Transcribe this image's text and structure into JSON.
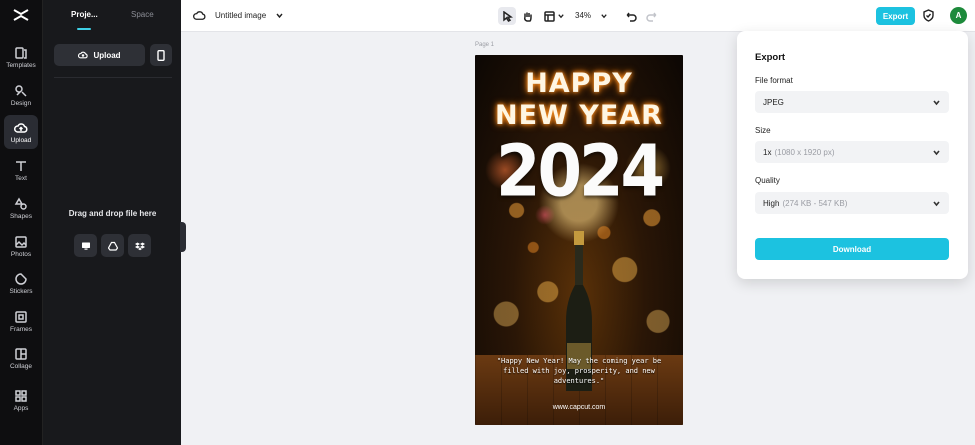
{
  "rail": {
    "items": [
      {
        "label": "Templates",
        "icon": "templates-icon"
      },
      {
        "label": "Design",
        "icon": "design-icon"
      },
      {
        "label": "Upload",
        "icon": "upload-cloud-icon",
        "active": true
      },
      {
        "label": "Text",
        "icon": "text-icon"
      },
      {
        "label": "Shapes",
        "icon": "shapes-icon"
      },
      {
        "label": "Photos",
        "icon": "photos-icon"
      },
      {
        "label": "Stickers",
        "icon": "stickers-icon"
      },
      {
        "label": "Frames",
        "icon": "frames-icon"
      },
      {
        "label": "Collage",
        "icon": "collage-icon"
      },
      {
        "label": "Apps",
        "icon": "apps-icon"
      }
    ]
  },
  "panel": {
    "tabs": [
      "Proje...",
      "Space"
    ],
    "upload_label": "Upload",
    "drop_text": "Drag and drop file here"
  },
  "topbar": {
    "doc_title": "Untitled image",
    "zoom": "34%",
    "export_label": "Export",
    "avatar_initial": "A"
  },
  "canvas": {
    "page_label": "Page 1",
    "poster": {
      "line1": "HAPPY",
      "line2": "NEW YEAR",
      "year": "2024",
      "quote": "\"Happy New Year! May the coming year be filled with joy, prosperity, and new adventures.\"",
      "site": "www.capcut.com"
    }
  },
  "export_panel": {
    "title": "Export",
    "file_format_label": "File format",
    "file_format_value": "JPEG",
    "size_label": "Size",
    "size_value": "1x",
    "size_hint": "(1080 x 1920 px)",
    "quality_label": "Quality",
    "quality_value": "High",
    "quality_hint": "(274 KB - 547 KB)",
    "download_label": "Download"
  },
  "colors": {
    "accent": "#1cc2e0",
    "rail_bg": "#0e0e10",
    "panel_bg": "#18191c",
    "avatar": "#1d8a3b"
  }
}
